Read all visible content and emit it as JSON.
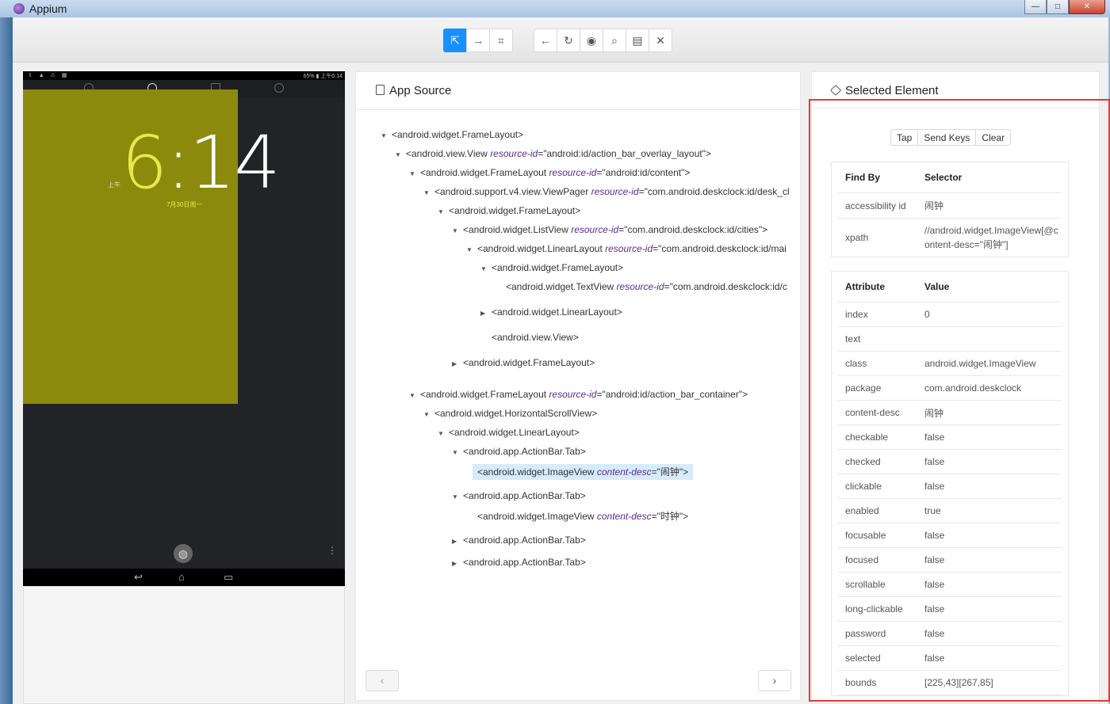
{
  "window": {
    "title": "Appium",
    "minimize_label": "—",
    "maximize_label": "□",
    "close_label": "✕"
  },
  "toolbar": {
    "group1": [
      {
        "name": "select-elements",
        "icon": "⇱"
      },
      {
        "name": "swipe-by-coordinates",
        "icon": "→"
      },
      {
        "name": "tap-by-coordinates",
        "icon": "⌗"
      }
    ],
    "group2": [
      {
        "name": "back",
        "icon": "←"
      },
      {
        "name": "refresh",
        "icon": "↻"
      },
      {
        "name": "recorder",
        "icon": "◉"
      },
      {
        "name": "search",
        "icon": "⌕"
      },
      {
        "name": "copy-xml",
        "icon": "▤"
      },
      {
        "name": "quit-session",
        "icon": "✕"
      }
    ]
  },
  "device": {
    "status_right": "65% ▮ 上午6:14",
    "status_left": "⇩ ▲ ⚠ ▦",
    "clock_prefix": "6",
    "clock_rest": ":14",
    "ampm": "上午",
    "date": "7月30日周一",
    "fab_icon": "◍",
    "overflow": "⋮",
    "nav_back": "↩",
    "nav_home": "⌂",
    "nav_recent": "▭"
  },
  "app_source": {
    "title": "App Source",
    "prev": "‹",
    "next": "›"
  },
  "tree": [
    {
      "caret": "▼",
      "tag": "<android.widget.FrameLayout>",
      "attr": "",
      "val": "",
      "end": ""
    },
    {
      "caret": "▼",
      "tag": "<android.view.View ",
      "attr": "resource-id",
      "val": "=\"android:id/action_bar_overlay_layout\"",
      "end": ">"
    },
    {
      "caret": "▼",
      "tag": "<android.widget.FrameLayout ",
      "attr": "resource-id",
      "val": "=\"android:id/content\"",
      "end": ">"
    },
    {
      "caret": "▼",
      "tag": "<android.support.v4.view.ViewPager ",
      "attr": "resource-id",
      "val": "=\"com.android.deskclock:id/desk_cl",
      "end": ""
    },
    {
      "caret": "▼",
      "tag": "<android.widget.FrameLayout>",
      "attr": "",
      "val": "",
      "end": ""
    },
    {
      "caret": "▼",
      "tag": "<android.widget.ListView ",
      "attr": "resource-id",
      "val": "=\"com.android.deskclock:id/cities\"",
      "end": ">"
    },
    {
      "caret": "▼",
      "tag": "<android.widget.LinearLayout ",
      "attr": "resource-id",
      "val": "=\"com.android.deskclock:id/mai",
      "end": ""
    },
    {
      "caret": "▼",
      "tag": "<android.widget.FrameLayout>",
      "attr": "",
      "val": "",
      "end": ""
    },
    {
      "caret": "",
      "tag": "<android.widget.TextView ",
      "attr": "resource-id",
      "val": "=\"com.android.deskclock:id/c",
      "end": ""
    },
    {
      "caret": "▶",
      "tag": "<android.widget.LinearLayout>",
      "attr": "",
      "val": "",
      "end": ""
    },
    {
      "caret": "",
      "tag": "<android.view.View>",
      "attr": "",
      "val": "",
      "end": ""
    },
    {
      "caret": "▶",
      "tag": "<android.widget.FrameLayout>",
      "attr": "",
      "val": "",
      "end": ""
    },
    {
      "caret": "▼",
      "tag": "<android.widget.FrameLayout ",
      "attr": "resource-id",
      "val": "=\"android:id/action_bar_container\"",
      "end": ">"
    },
    {
      "caret": "▼",
      "tag": "<android.widget.HorizontalScrollView>",
      "attr": "",
      "val": "",
      "end": ""
    },
    {
      "caret": "▼",
      "tag": "<android.widget.LinearLayout>",
      "attr": "",
      "val": "",
      "end": ""
    },
    {
      "caret": "▼",
      "tag": "<android.app.ActionBar.Tab>",
      "attr": "",
      "val": "",
      "end": ""
    },
    {
      "caret": "",
      "tag": "<android.widget.ImageView ",
      "attr": "content-desc",
      "val": "=\"闹钟\"",
      "end": ">"
    },
    {
      "caret": "▼",
      "tag": "<android.app.ActionBar.Tab>",
      "attr": "",
      "val": "",
      "end": ""
    },
    {
      "caret": "",
      "tag": "<android.widget.ImageView ",
      "attr": "content-desc",
      "val": "=\"时钟\"",
      "end": ">"
    },
    {
      "caret": "▶",
      "tag": "<android.app.ActionBar.Tab>",
      "attr": "",
      "val": "",
      "end": ""
    },
    {
      "caret": "▶",
      "tag": "<android.app.ActionBar.Tab>",
      "attr": "",
      "val": "",
      "end": ""
    }
  ],
  "selected": {
    "title": "Selected Element",
    "actions": [
      "Tap",
      "Send Keys",
      "Clear"
    ],
    "find_by_header": [
      "Find By",
      "Selector"
    ],
    "find_by": [
      {
        "k": "accessibility id",
        "v": "闹钟"
      },
      {
        "k": "xpath",
        "v": "//android.widget.ImageView[@content-desc=\"闹钟\"]"
      }
    ],
    "attr_header": [
      "Attribute",
      "Value"
    ],
    "attributes": [
      {
        "k": "index",
        "v": "0"
      },
      {
        "k": "text",
        "v": ""
      },
      {
        "k": "class",
        "v": "android.widget.ImageView"
      },
      {
        "k": "package",
        "v": "com.android.deskclock"
      },
      {
        "k": "content-desc",
        "v": "闹钟"
      },
      {
        "k": "checkable",
        "v": "false"
      },
      {
        "k": "checked",
        "v": "false"
      },
      {
        "k": "clickable",
        "v": "false"
      },
      {
        "k": "enabled",
        "v": "true"
      },
      {
        "k": "focusable",
        "v": "false"
      },
      {
        "k": "focused",
        "v": "false"
      },
      {
        "k": "scrollable",
        "v": "false"
      },
      {
        "k": "long-clickable",
        "v": "false"
      },
      {
        "k": "password",
        "v": "false"
      },
      {
        "k": "selected",
        "v": "false"
      },
      {
        "k": "bounds",
        "v": "[225,43][267,85]"
      }
    ]
  },
  "colors": {
    "accent": "#1890ff",
    "highlight_overlay": "#8c8a0c",
    "selection_box": "#e53935"
  }
}
